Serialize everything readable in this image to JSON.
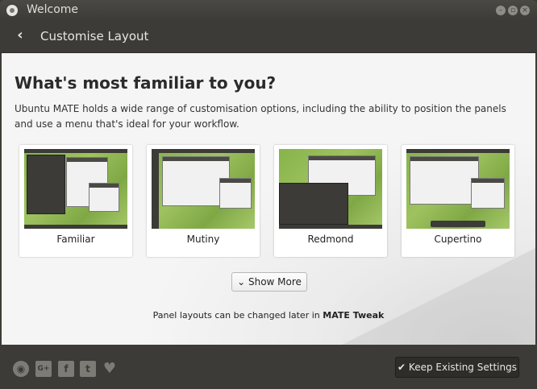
{
  "window": {
    "title": "Welcome"
  },
  "header": {
    "title": "Customise Layout"
  },
  "main": {
    "heading": "What's most familiar to you?",
    "description": "Ubuntu MATE holds a wide range of customisation options, including the ability to position the panels and use a menu that's ideal for your workflow.",
    "layouts": [
      {
        "label": "Familiar"
      },
      {
        "label": "Mutiny"
      },
      {
        "label": "Redmond"
      },
      {
        "label": "Cupertino"
      }
    ],
    "show_more_label": "Show More",
    "footnote_prefix": "Panel layouts can be changed later in ",
    "footnote_app": "MATE Tweak"
  },
  "footer": {
    "icons": [
      "ubuntu-mate-icon",
      "google-plus-icon",
      "facebook-icon",
      "twitter-icon",
      "heart-icon"
    ],
    "keep_label": "Keep Existing Settings"
  },
  "colors": {
    "accent": "#87a556",
    "titlebar": "#3c3b37",
    "content_bg": "#f5f5f5"
  }
}
